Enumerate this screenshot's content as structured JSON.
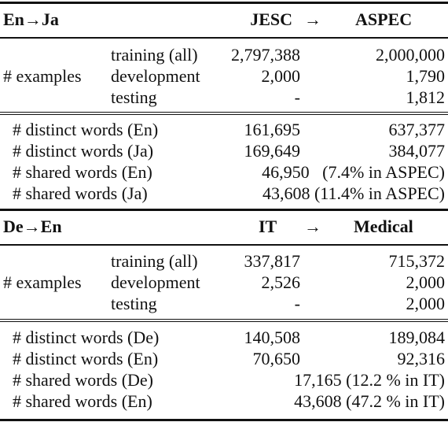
{
  "table": {
    "sections": [
      {
        "pair": "En→Ja",
        "source_domain": "JESC",
        "arrow": "→",
        "target_domain": "ASPEC",
        "examples_label": "# examples",
        "examples": [
          {
            "split": "training (all)",
            "source": "2,797,388",
            "target": "2,000,000"
          },
          {
            "split": "development",
            "source": "2,000",
            "target": "1,790"
          },
          {
            "split": "testing",
            "source": "-",
            "target": "1,812"
          }
        ],
        "stats": [
          {
            "label": "# distinct words (En)",
            "source": "161,695",
            "target": "637,377"
          },
          {
            "label": "# distinct words (Ja)",
            "source": "169,649",
            "target": "384,077"
          },
          {
            "label": "# shared words (En)",
            "merged": "46,950   (7.4% in ASPEC)"
          },
          {
            "label": "# shared words (Ja)",
            "merged": "43,608 (11.4% in ASPEC)"
          }
        ]
      },
      {
        "pair": "De→En",
        "source_domain": "IT",
        "arrow": "→",
        "target_domain": "Medical",
        "examples_label": "# examples",
        "examples": [
          {
            "split": "training (all)",
            "source": "337,817",
            "target": "715,372"
          },
          {
            "split": "development",
            "source": "2,526",
            "target": "2,000"
          },
          {
            "split": "testing",
            "source": "-",
            "target": "2,000"
          }
        ],
        "stats": [
          {
            "label": "# distinct words (De)",
            "source": "140,508",
            "target": "189,084"
          },
          {
            "label": "# distinct words (En)",
            "source": "70,650",
            "target": "92,316"
          },
          {
            "label": "# shared words (De)",
            "merged": "17,165 (12.2 % in IT)"
          },
          {
            "label": "# shared words (En)",
            "merged": "43,608 (47.2 % in IT)"
          }
        ]
      }
    ]
  }
}
